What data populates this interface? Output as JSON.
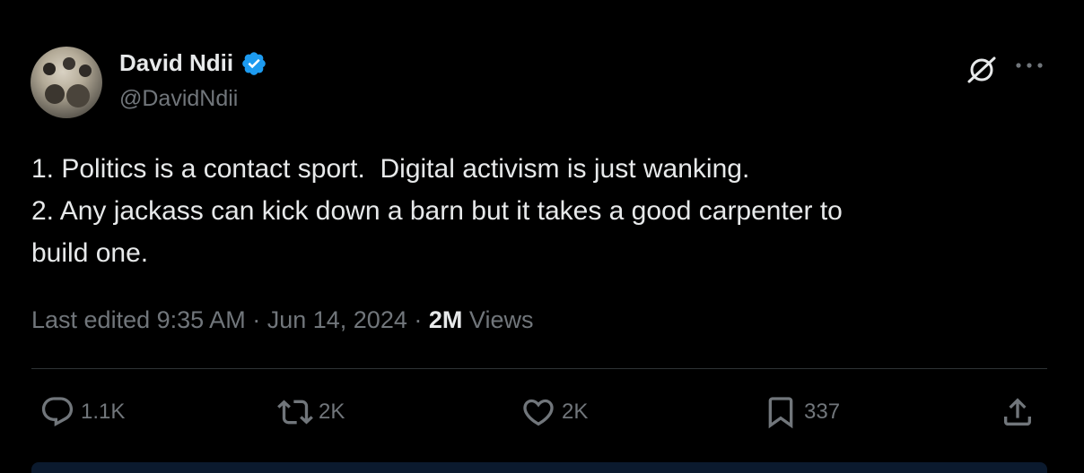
{
  "author": {
    "name": "David Ndii",
    "handle": "@DavidNdii",
    "verified_color": "#1d9bf0"
  },
  "tweet": {
    "lines": [
      "1. Politics is a contact sport.  Digital activism is just wanking.",
      "2. Any jackass can kick down a barn but it takes a good carpenter to",
      "build one."
    ]
  },
  "meta": {
    "edited_label": "Last edited",
    "time": "9:35 AM",
    "separator": "·",
    "date": "Jun 14, 2024",
    "views_count": "2M",
    "views_label": "Views"
  },
  "actions": {
    "replies": "1.1K",
    "reposts": "2K",
    "likes": "2K",
    "bookmarks": "337"
  },
  "icons": {
    "header": [
      "grok-icon",
      "more-icon"
    ],
    "actions": [
      "reply-icon",
      "repost-icon",
      "like-icon",
      "bookmark-icon",
      "share-icon"
    ]
  },
  "colors": {
    "background": "#000000",
    "text": "#e7e9ea",
    "muted": "#71767b",
    "divider": "#2f3336"
  }
}
